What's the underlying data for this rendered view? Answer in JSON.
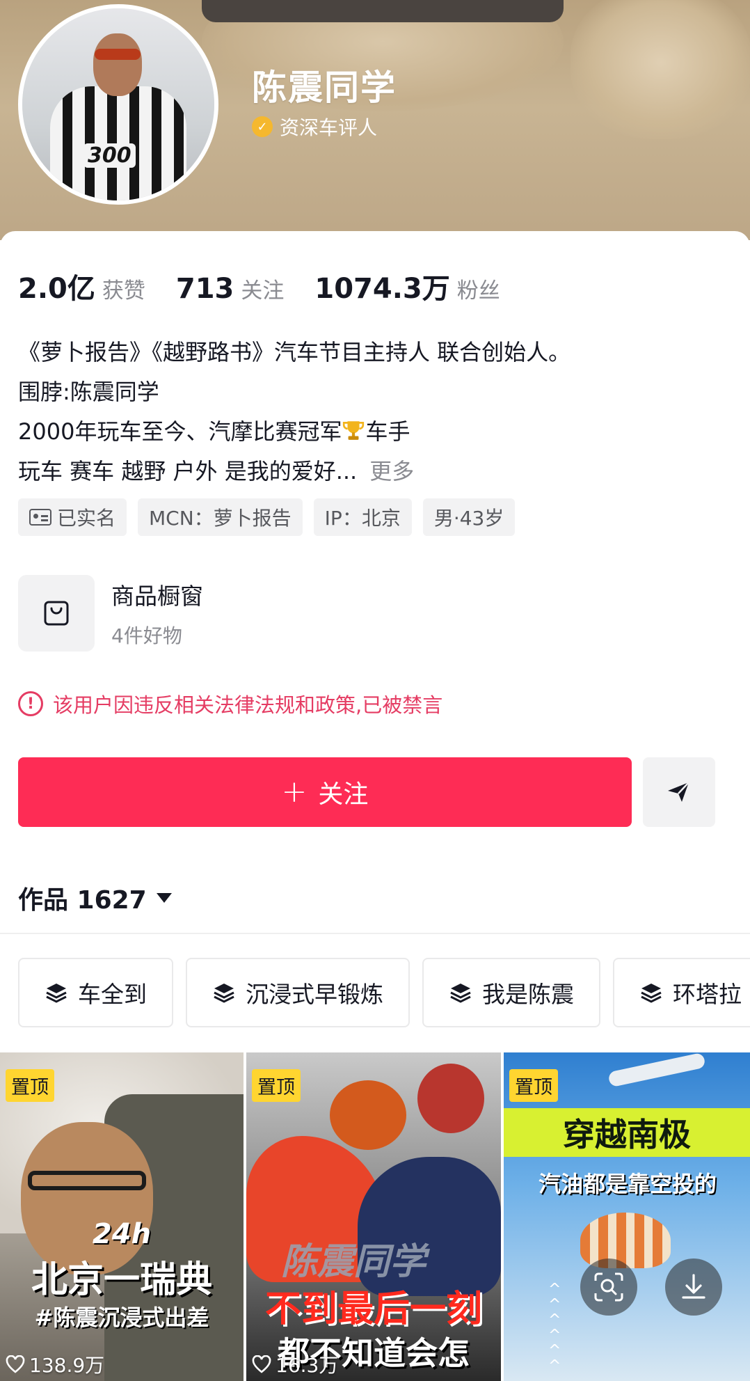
{
  "profile": {
    "name": "陈震同学",
    "verify_label": "资深车评人",
    "stats": [
      {
        "value": "2.0亿",
        "label": "获赞"
      },
      {
        "value": "713",
        "label": "关注"
      },
      {
        "value": "1074.3万",
        "label": "粉丝"
      }
    ],
    "bio_lines": [
      "《萝卜报告》《越野路书》汽车节目主持人 联合创始人。",
      "围脖:陈震同学",
      "2000年玩车至今、汽摩比赛冠军",
      "车手",
      "玩车 赛车 越野 户外 是我的爱好..."
    ],
    "bio_more": "更多",
    "tags": [
      "已实名",
      "MCN：萝卜报告",
      "IP：北京",
      "男·43岁"
    ],
    "avatar_number": "300"
  },
  "shop": {
    "title": "商品橱窗",
    "subtitle": "4件好物"
  },
  "warning": "该用户因违反相关法律法规和政策,已被禁言",
  "actions": {
    "follow_label": "关注"
  },
  "works": {
    "label": "作品 1627"
  },
  "collections": [
    "车全到",
    "沉浸式早锻炼",
    "我是陈震",
    "环塔拉"
  ],
  "videos": [
    {
      "pin": "置顶",
      "cap1": "24h",
      "cap2": "北京一瑞典",
      "cap3": "#陈震沉浸式出差",
      "likes": "138.9万"
    },
    {
      "pin": "置顶",
      "cap1": "陈震同学",
      "cap2": "不到最后一刻",
      "cap3": "都不知道会怎",
      "likes": "16.3万"
    },
    {
      "pin": "置顶",
      "cap1": "穿越南极",
      "cap2": "汽油都是靠空投的"
    }
  ],
  "colors": {
    "accent": "#fe2c55",
    "warning": "#e53c63",
    "pin": "#ffd530",
    "verify": "#f5b82e"
  }
}
